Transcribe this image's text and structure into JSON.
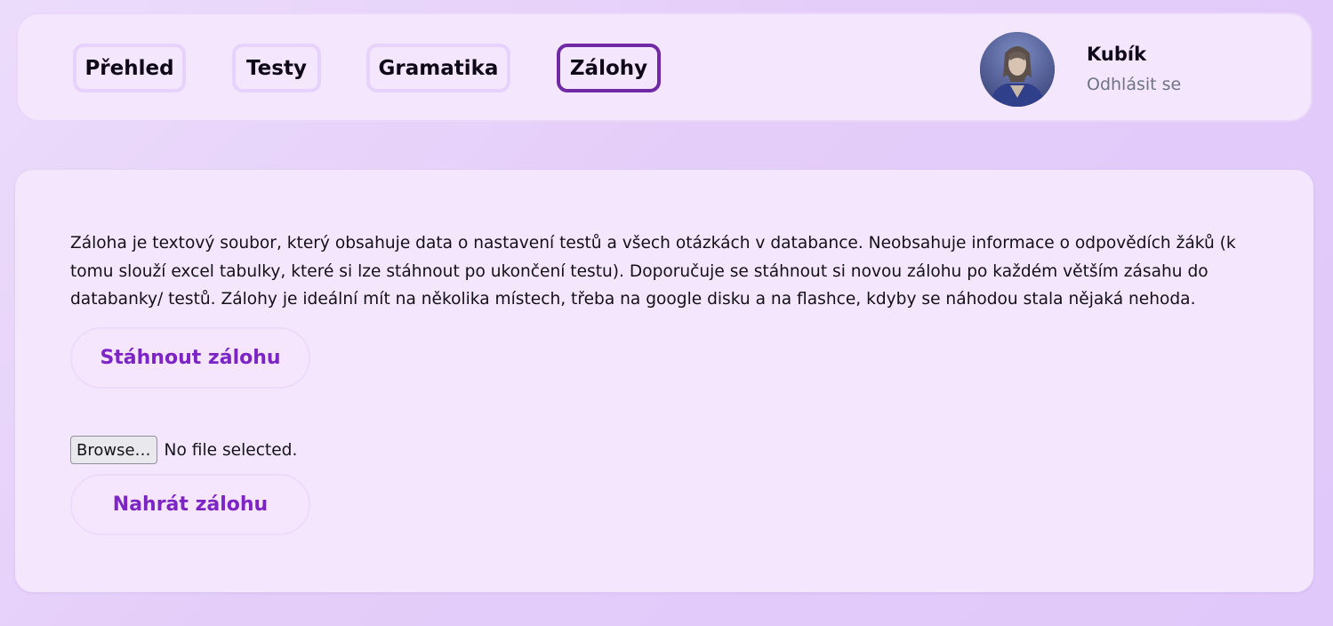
{
  "nav": {
    "items": [
      {
        "label": "Přehled",
        "active": false
      },
      {
        "label": "Testy",
        "active": false
      },
      {
        "label": "Gramatika",
        "active": false
      },
      {
        "label": "Zálohy",
        "active": true
      }
    ]
  },
  "user": {
    "name": "Kubík",
    "logout_label": "Odhlásit se"
  },
  "backup": {
    "description": "Záloha je textový soubor, který obsahuje data o nastavení testů a všech otázkách v databance. Neobsahuje informace o odpovědích žáků (k tomu slouží excel tabulky, které si lze stáhnout po ukončení testu). Doporučuje se stáhnout si novou zálohu po každém větším zásahu do databanky/ testů. Zálohy je ideální mít na několika místech, třeba na google disku a na flashce, kdyby se náhodou stala nějaká nehoda.",
    "download_label": "Stáhnout zálohu",
    "file_input": {
      "browse_label": "Browse…",
      "status": "No file selected."
    },
    "upload_label": "Nahrát zálohu"
  },
  "colors": {
    "background": "#e6d0fa",
    "panel": "#f4e6fd",
    "accent": "#7c24c4",
    "active_border": "#6f2aa4",
    "muted_text": "#6f7485"
  }
}
